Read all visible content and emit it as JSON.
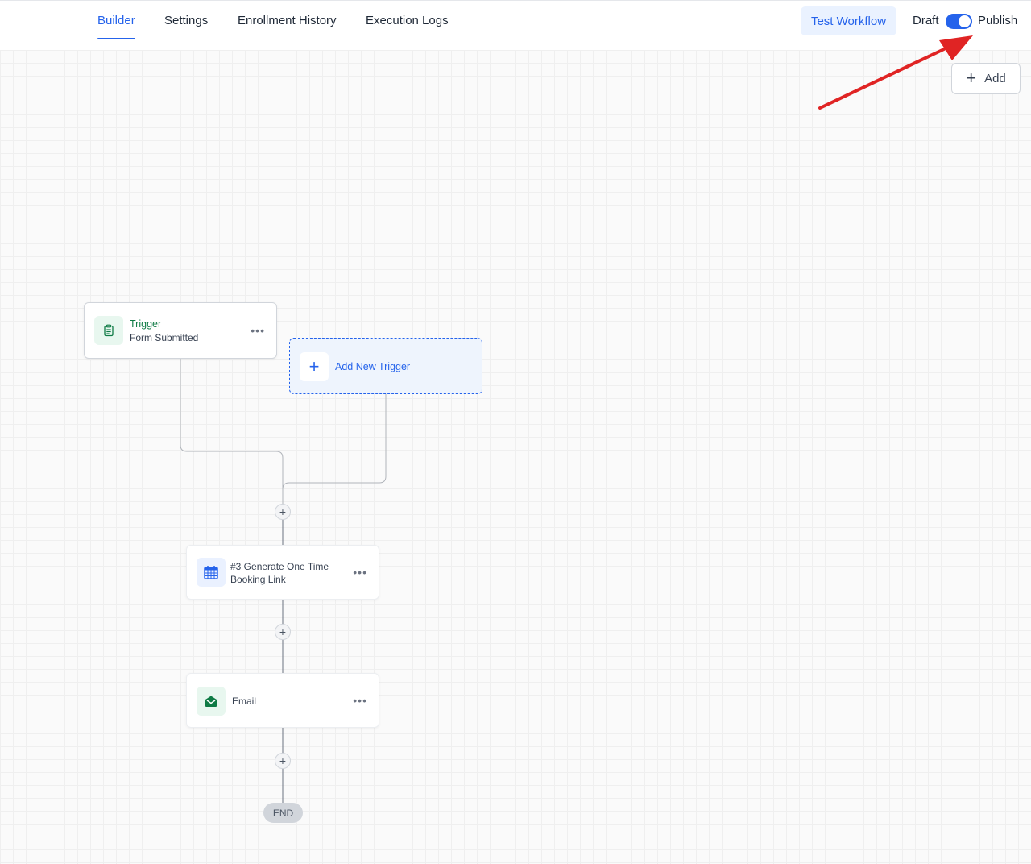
{
  "nav": {
    "tabs": [
      {
        "label": "Builder",
        "active": true
      },
      {
        "label": "Settings",
        "active": false
      },
      {
        "label": "Enrollment History",
        "active": false
      },
      {
        "label": "Execution Logs",
        "active": false
      }
    ],
    "test_button": "Test Workflow",
    "status": {
      "draft_label": "Draft",
      "publish_label": "Publish",
      "published": true
    }
  },
  "canvas": {
    "add_button": "Add",
    "trigger": {
      "title": "Trigger",
      "subtitle": "Form Submitted",
      "icon": "clipboard-icon"
    },
    "add_trigger": {
      "label": "Add New Trigger",
      "icon": "plus-icon"
    },
    "actions": [
      {
        "title": "#3 Generate One Time Booking Link",
        "icon": "calendar-icon"
      },
      {
        "title": "Email",
        "icon": "envelope-icon"
      }
    ],
    "end_label": "END"
  },
  "colors": {
    "accent": "#2563eb",
    "trigger_green": "#0f7b45",
    "annotation_arrow": "#e02424"
  }
}
